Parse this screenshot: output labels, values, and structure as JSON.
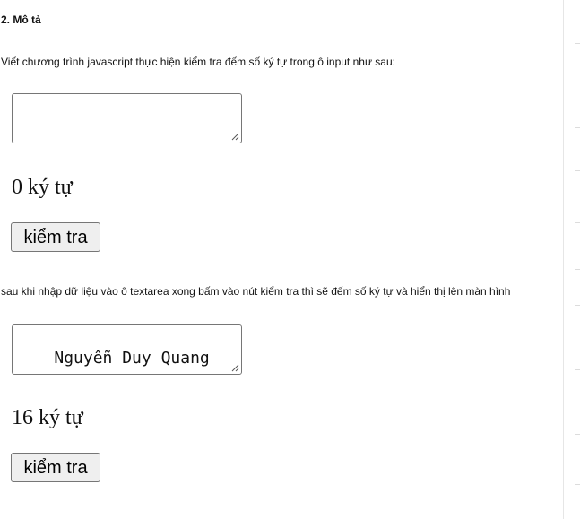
{
  "section": {
    "heading": "2. Mô tả",
    "intro": "Viết chương trình javascript thực hiện kiểm tra đếm số ký tự trong ô input như sau:",
    "explanation": "sau khi nhập dữ liệu vào ô textarea xong bấm vào nút kiểm tra thì sẽ đếm số ký tự và hiển thị lên màn hình"
  },
  "example_empty": {
    "textarea_value": "",
    "count_text": "0 ký tự",
    "button_label": "kiểm tra"
  },
  "example_filled": {
    "textarea_value": "Nguyễn Duy Quang",
    "count_text": "16 ký tự",
    "button_label": "kiểm tra"
  },
  "colors": {
    "border": "#767676",
    "button_bg": "#efefef",
    "text": "#111111"
  }
}
